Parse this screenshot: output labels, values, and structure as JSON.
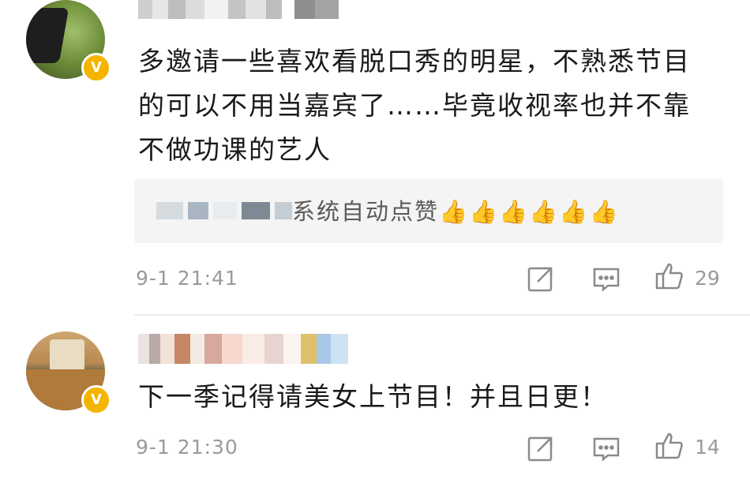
{
  "comments": [
    {
      "text_lines": [
        "多邀请一些喜欢看脱口秀的明星，不熟悉节目",
        "的可以不用当嘉宾了……毕竟收视率也并不靠",
        "不做功课的艺人"
      ],
      "reply": {
        "text": "系统自动点赞👍👍👍👍👍👍"
      },
      "time": "9-1 21:41",
      "like_count": "29",
      "badge": "V"
    },
    {
      "text_lines": [
        "下一季记得请美女上节目！并且日更！"
      ],
      "time": "9-1 21:30",
      "like_count": "14",
      "badge": "V"
    }
  ],
  "icons": {
    "share": "share-icon",
    "reply": "comment-icon",
    "like": "thumbs-up-icon"
  },
  "colors": {
    "meta_text": "#9a9a9a",
    "badge": "#f5b400",
    "reply_bg": "#f4f4f4"
  }
}
